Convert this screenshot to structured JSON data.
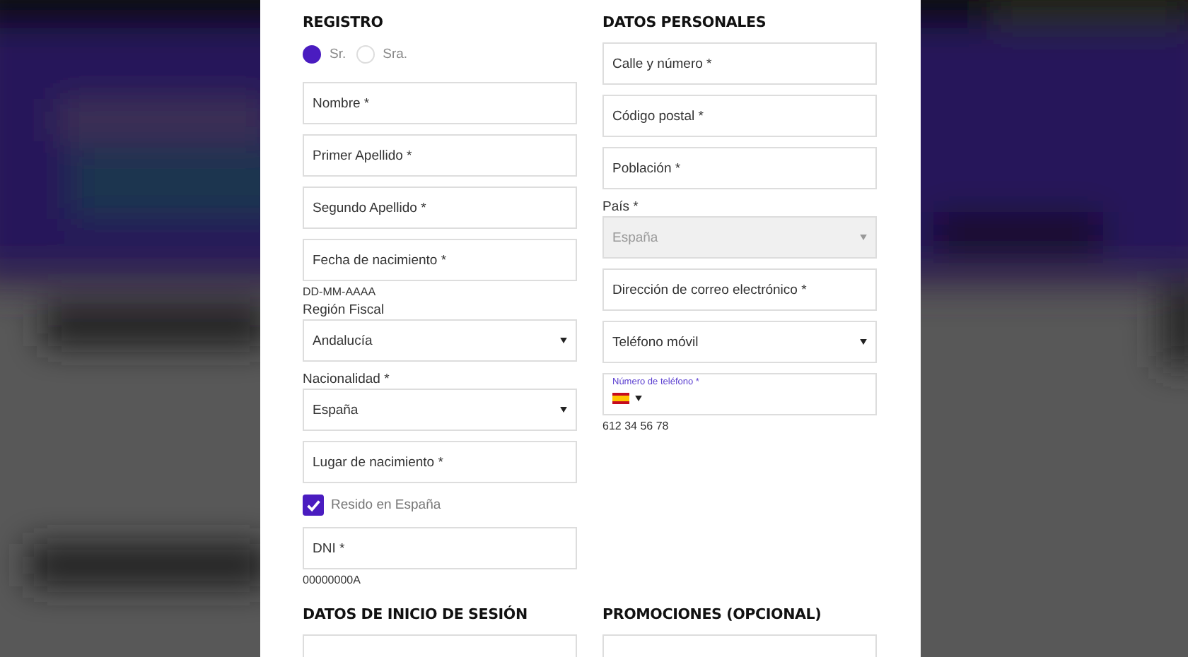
{
  "form": {
    "columns": [
      {
        "heading": "REGISTRO",
        "items": [
          {
            "kind": "radio_group",
            "options": [
              {
                "label": "Sr.",
                "selected": true
              },
              {
                "label": "Sra.",
                "selected": false
              }
            ]
          },
          {
            "kind": "input",
            "placeholder": "Nombre *"
          },
          {
            "kind": "input",
            "placeholder": "Primer Apellido *"
          },
          {
            "kind": "input",
            "placeholder": "Segundo Apellido *"
          },
          {
            "kind": "input",
            "placeholder": "Fecha de nacimiento *",
            "hint": "DD-MM-AAAA"
          },
          {
            "kind": "select",
            "label": "Región Fiscal",
            "value": "Andalucía",
            "disabled": false
          },
          {
            "kind": "select",
            "label": "Nacionalidad *",
            "value": "España",
            "disabled": false
          },
          {
            "kind": "input",
            "placeholder": "Lugar de nacimiento *"
          },
          {
            "kind": "checkbox",
            "label": "Resido en España",
            "checked": true
          },
          {
            "kind": "input",
            "placeholder": "DNI *",
            "hint": "00000000A"
          }
        ]
      },
      {
        "heading": "DATOS PERSONALES",
        "items": [
          {
            "kind": "input",
            "placeholder": "Calle y número *"
          },
          {
            "kind": "input",
            "placeholder": "Código postal *"
          },
          {
            "kind": "input",
            "placeholder": "Población *"
          },
          {
            "kind": "select",
            "label": "País *",
            "value": "España",
            "disabled": true
          },
          {
            "kind": "input",
            "placeholder": "Dirección de correo electrónico *"
          },
          {
            "kind": "select",
            "value": "Teléfono móvil",
            "disabled": false
          },
          {
            "kind": "phone",
            "label": "Número de teléfono *",
            "hint": "612 34 56 78"
          }
        ]
      },
      {
        "heading": "DATOS DE INICIO DE SESIÓN",
        "items": [
          {
            "kind": "input"
          }
        ]
      },
      {
        "heading": "PROMOCIONES (OPCIONAL)",
        "items": [
          {
            "kind": "input"
          }
        ]
      }
    ]
  }
}
